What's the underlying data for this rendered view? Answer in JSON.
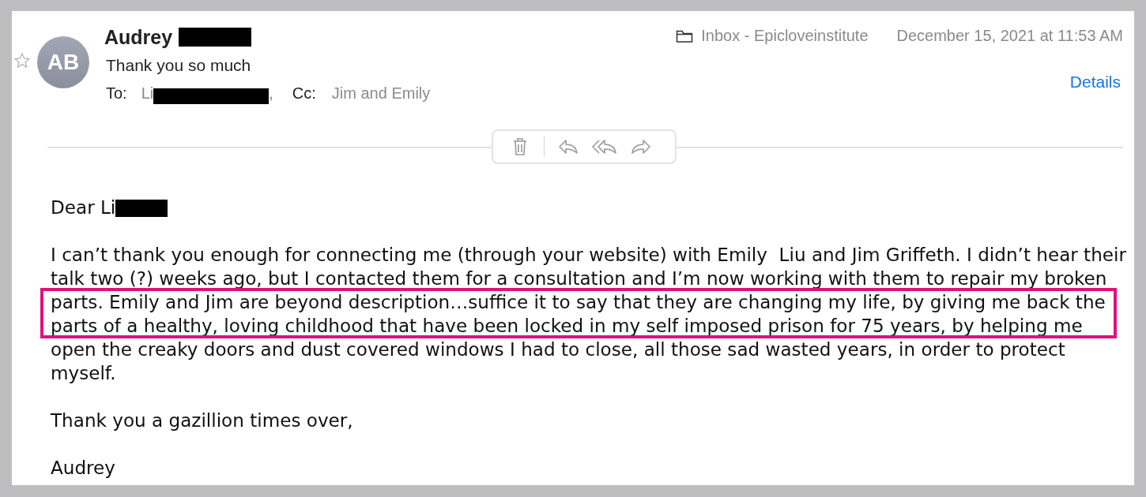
{
  "message": {
    "flagged": false,
    "avatar_initials": "AB",
    "sender": {
      "name": "Audrey",
      "redacted": true
    },
    "subject": "Thank you so much",
    "to": {
      "label": "To:",
      "name": "Li",
      "redacted": true,
      "suffix": ","
    },
    "cc": {
      "label": "Cc:",
      "name": "Jim and Emily"
    },
    "mailbox": "Inbox - Epicloveinstitute",
    "date": "December 15, 2021 at 11:53 AM",
    "details_link": "Details",
    "toolbar": [
      {
        "kind": "trash"
      },
      {
        "kind": "reply"
      },
      {
        "kind": "reply_all"
      },
      {
        "kind": "forward"
      }
    ],
    "greeting": {
      "text": "Dear Li",
      "redacted": true
    },
    "paragraph": [
      {
        "text": "I can’t thank you enough for connecting me (through your website) with Emily  Liu and Jim Griffeth. I didn’t hear their",
        "highlighted": false
      },
      {
        "text": "talk two (?) weeks ago, but I contacted them for a consultation and I’m now working with them to repair my broken",
        "highlighted": false
      },
      {
        "text": "parts. Emily and Jim are beyond description…suffice it to say that they are changing my life, by giving me back the",
        "highlighted": true
      },
      {
        "text": "parts of a healthy, loving childhood that have been locked in my self imposed prison for 75 years, by helping me",
        "highlighted": true
      },
      {
        "text": "open the creaky doors and dust covered windows I had to close, all those sad wasted years, in order to protect",
        "highlighted": false
      },
      {
        "text": "myself.",
        "highlighted": false
      }
    ],
    "closing": "Thank you a gazillion times over,",
    "signature": "Audrey"
  }
}
